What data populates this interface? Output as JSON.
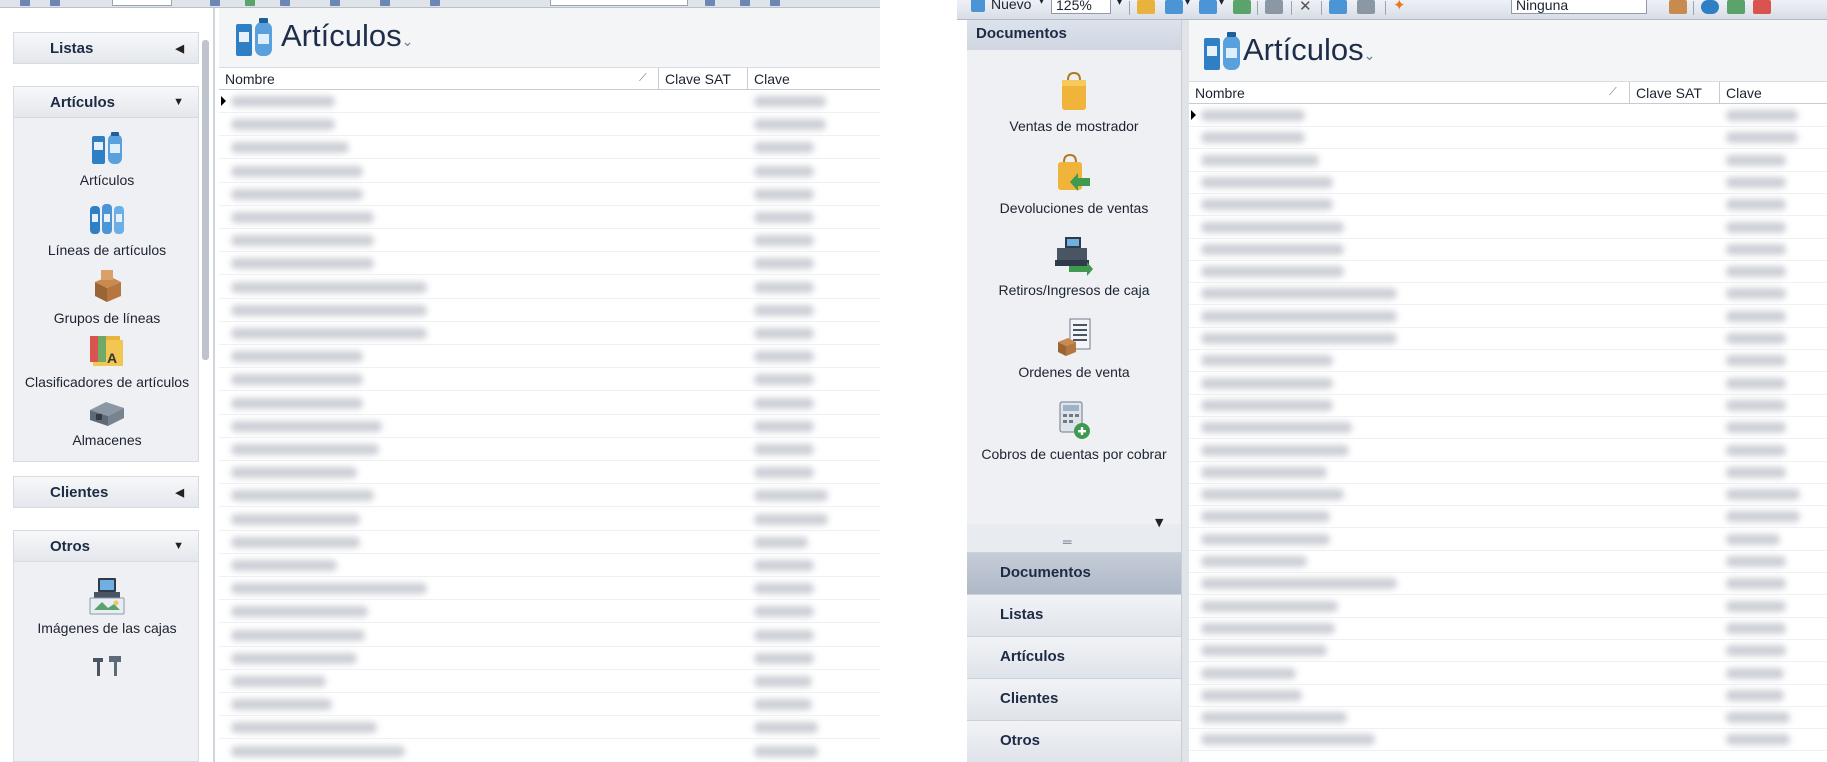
{
  "left": {
    "sidebar": {
      "sections": [
        {
          "label": "Listas",
          "arrow": "◀"
        },
        {
          "label": "Artículos",
          "arrow": "▼"
        },
        {
          "label": "Clientes",
          "arrow": "◀"
        },
        {
          "label": "Otros",
          "arrow": "▼"
        }
      ],
      "articulos_items": [
        {
          "label": "Artículos",
          "icon": "articles-icon"
        },
        {
          "label": "Líneas de artículos",
          "icon": "article-lines-icon"
        },
        {
          "label": "Grupos de líneas",
          "icon": "line-groups-icon"
        },
        {
          "label": "Clasificadores de artículos",
          "icon": "classifiers-icon"
        },
        {
          "label": "Almacenes",
          "icon": "warehouses-icon"
        }
      ],
      "otros_items": [
        {
          "label": "Imágenes de las cajas",
          "icon": "register-images-icon"
        },
        {
          "label": "",
          "icon": "scale-icon"
        }
      ]
    },
    "main": {
      "title": "Artículos",
      "columns": [
        "Nombre",
        "Clave SAT",
        "Clave"
      ]
    }
  },
  "right": {
    "toolbar": {
      "new_label": "Nuevo",
      "zoom": "125%",
      "filter_value": "Ninguna"
    },
    "sidebar": {
      "header": "Documentos",
      "items": [
        {
          "label": "Ventas de mostrador",
          "icon": "counter-sales-icon"
        },
        {
          "label": "Devoluciones de ventas",
          "icon": "sales-returns-icon"
        },
        {
          "label": "Retiros/Ingresos de caja",
          "icon": "cash-withdrawals-icon"
        },
        {
          "label": "Ordenes de venta",
          "icon": "sales-orders-icon"
        },
        {
          "label": "Cobros de cuentas por cobrar",
          "icon": "receivables-icon"
        }
      ],
      "nav": [
        "Documentos",
        "Listas",
        "Artículos",
        "Clientes",
        "Otros"
      ],
      "active_nav": "Documentos"
    },
    "main": {
      "title": "Artículos",
      "columns": [
        "Nombre",
        "Clave SAT",
        "Clave"
      ]
    }
  },
  "colors": {
    "header_text": "#1e2d4a",
    "panel_bg": "#eef0f3",
    "active_nav": "#b4bdcb"
  }
}
